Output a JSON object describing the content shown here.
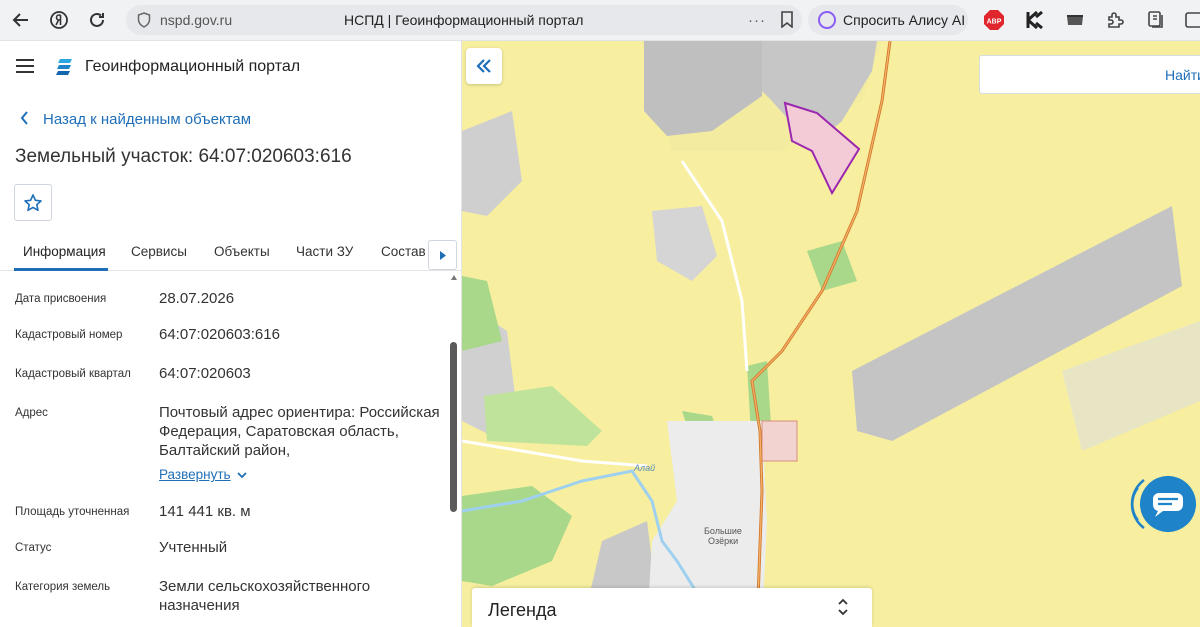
{
  "browser": {
    "url": "nspd.gov.ru",
    "tab_title": "НСПД | Геоинформационный портал",
    "alice_label": "Спросить Алису AI",
    "abp_label": "ABP"
  },
  "app": {
    "title": "Геоинформационный портал",
    "back_label": "Назад к найденным объектам",
    "page_title": "Земельный участок: 64:07:020603:616"
  },
  "tabs": [
    {
      "label": "Информация",
      "active": true
    },
    {
      "label": "Сервисы"
    },
    {
      "label": "Объекты"
    },
    {
      "label": "Части ЗУ"
    },
    {
      "label": "Состав"
    }
  ],
  "info": {
    "rows": [
      {
        "label": "Дата присвоения",
        "value": "28.07.2026"
      },
      {
        "label": "Кадастровый номер",
        "value": "64:07:020603:616"
      },
      {
        "label": "Кадастровый квартал",
        "value": "64:07:020603"
      },
      {
        "label": "Адрес",
        "value": "Почтовый адрес ориентира: Российская Федерация, Саратовская область, Балтайский район,"
      },
      {
        "label": "Площадь уточненная",
        "value": "141 441 кв. м"
      },
      {
        "label": "Статус",
        "value": "Учтенный"
      },
      {
        "label": "Категория земель",
        "value": "Земли сельскохозяйственного назначения"
      }
    ],
    "expand_label": "Развернуть"
  },
  "map": {
    "search_button": "Найти",
    "legend_title": "Легенда",
    "labels": {
      "river": "Алай",
      "village_line1": "Большие",
      "village_line2": "Озёрки"
    }
  },
  "colors": {
    "accent": "#1f6fb8",
    "parcel_outline": "#9b27b0",
    "map_field": "#f7ef9f",
    "map_forest": "#a9d88a",
    "map_gray": "#c9c9c9"
  }
}
